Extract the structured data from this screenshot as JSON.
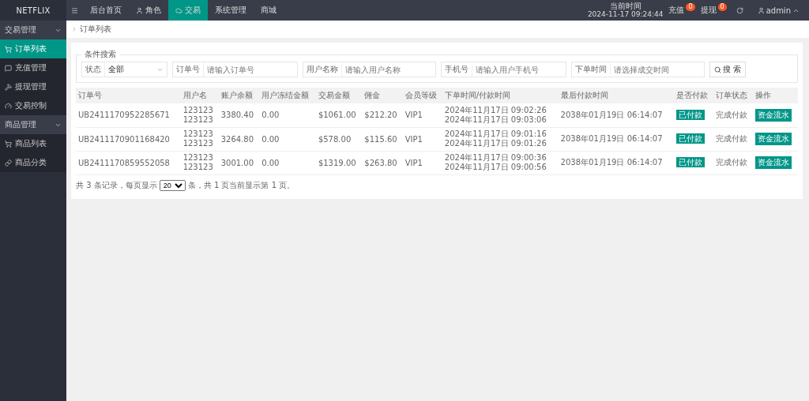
{
  "brand": {
    "name": "NETFLIX"
  },
  "top_nav": [
    {
      "label": "后台首页",
      "selected": false
    },
    {
      "label": "角色",
      "selected": false
    },
    {
      "label": "交易",
      "selected": true
    },
    {
      "label": "系统管理",
      "selected": false
    },
    {
      "label": "商城",
      "selected": false
    }
  ],
  "clock": {
    "label": "当前时间",
    "value": "2024-11-17 09:24:44"
  },
  "alerts": [
    {
      "label": "充值",
      "count": "0"
    },
    {
      "label": "提现",
      "count": "0"
    }
  ],
  "user": "admin",
  "sidebar": [
    {
      "label": "交易管理",
      "expanded": true,
      "children": [
        {
          "label": "订单列表",
          "selected": true
        },
        {
          "label": "充值管理",
          "selected": false
        },
        {
          "label": "提现管理",
          "selected": false
        },
        {
          "label": "交易控制",
          "selected": false
        }
      ]
    },
    {
      "label": "商品管理",
      "expanded": true,
      "children": [
        {
          "label": "商品列表",
          "selected": false
        },
        {
          "label": "商品分类",
          "selected": false
        }
      ]
    }
  ],
  "breadcrumb": "订单列表",
  "search": {
    "legend": "条件搜索",
    "status": {
      "label": "状态",
      "value": "全部"
    },
    "fields": [
      {
        "label": "订单号",
        "placeholder": "请输入订单号"
      },
      {
        "label": "用户名称",
        "placeholder": "请输入用户名称"
      },
      {
        "label": "手机号",
        "placeholder": "请输入用户手机号"
      },
      {
        "label": "下单时间",
        "placeholder": "请选择成交时间"
      }
    ],
    "button": "搜 索"
  },
  "table": {
    "columns": [
      "订单号",
      "用户名",
      "账户余额",
      "用户冻结金额",
      "交易金额",
      "佣金",
      "会员等级",
      "下单时间/付款时间",
      "最后付款时间",
      "是否付款",
      "订单状态",
      "操作"
    ],
    "rows": [
      {
        "order": "UB2411170952285671",
        "user": [
          "123123",
          "123123"
        ],
        "balance": "3380.40",
        "frozen": "0.00",
        "amount": "$1061.00",
        "commission": "$212.20",
        "level": "VIP1",
        "times": [
          "2024年11月17日 09:02:26",
          "2024年11月17日 09:03:06"
        ],
        "last": "2038年01月19日 06:14:07",
        "paid": "已付款",
        "status": "完成付款",
        "action": "资金流水"
      },
      {
        "order": "UB2411170901168420",
        "user": [
          "123123",
          "123123"
        ],
        "balance": "3264.80",
        "frozen": "0.00",
        "amount": "$578.00",
        "commission": "$115.60",
        "level": "VIP1",
        "times": [
          "2024年11月17日 09:01:16",
          "2024年11月17日 09:01:26"
        ],
        "last": "2038年01月19日 06:14:07",
        "paid": "已付款",
        "status": "完成付款",
        "action": "资金流水"
      },
      {
        "order": "UB2411170859552058",
        "user": [
          "123123",
          "123123"
        ],
        "balance": "3001.00",
        "frozen": "0.00",
        "amount": "$1319.00",
        "commission": "$263.80",
        "level": "VIP1",
        "times": [
          "2024年11月17日 09:00:36",
          "2024年11月17日 09:00:56"
        ],
        "last": "2038年01月19日 06:14:07",
        "paid": "已付款",
        "status": "完成付款",
        "action": "资金流水"
      }
    ]
  },
  "pagination": {
    "before": "共 3 条记录，每页显示",
    "page_size": "20",
    "after": "条，共 1 页当前显示第 1 页。"
  }
}
